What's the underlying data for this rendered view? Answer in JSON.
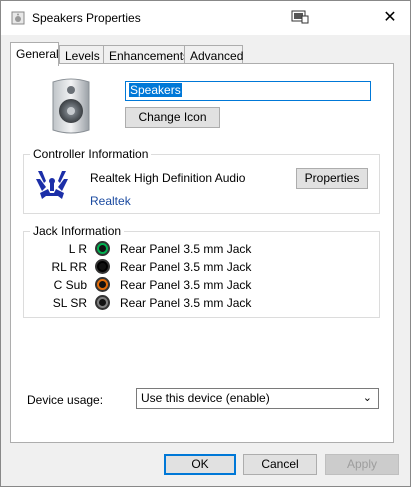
{
  "window": {
    "title": "Speakers Properties",
    "close_glyph": "✕"
  },
  "tabs": [
    {
      "label": "General",
      "active": true
    },
    {
      "label": "Levels",
      "active": false
    },
    {
      "label": "Enhancements",
      "active": false
    },
    {
      "label": "Advanced",
      "active": false
    }
  ],
  "general": {
    "device_name": "Speakers",
    "change_icon_label": "Change Icon",
    "controller": {
      "group_label": "Controller Information",
      "name": "Realtek High Definition Audio",
      "link": "Realtek",
      "properties_label": "Properties"
    },
    "jacks": {
      "group_label": "Jack Information",
      "rows": [
        {
          "channels": "L R",
          "description": "Rear Panel 3.5 mm Jack",
          "color": "#00b050"
        },
        {
          "channels": "RL RR",
          "description": "Rear Panel 3.5 mm Jack",
          "color": "#000000"
        },
        {
          "channels": "C Sub",
          "description": "Rear Panel 3.5 mm Jack",
          "color": "#e36c09"
        },
        {
          "channels": "SL SR",
          "description": "Rear Panel 3.5 mm Jack",
          "color": "#7f7f7f"
        }
      ]
    },
    "device_usage": {
      "label": "Device usage:",
      "selected": "Use this device (enable)"
    }
  },
  "footer": {
    "ok_label": "OK",
    "cancel_label": "Cancel",
    "apply_label": "Apply"
  },
  "colors": {
    "accent": "#0078d7",
    "link": "#1a4aa0"
  }
}
